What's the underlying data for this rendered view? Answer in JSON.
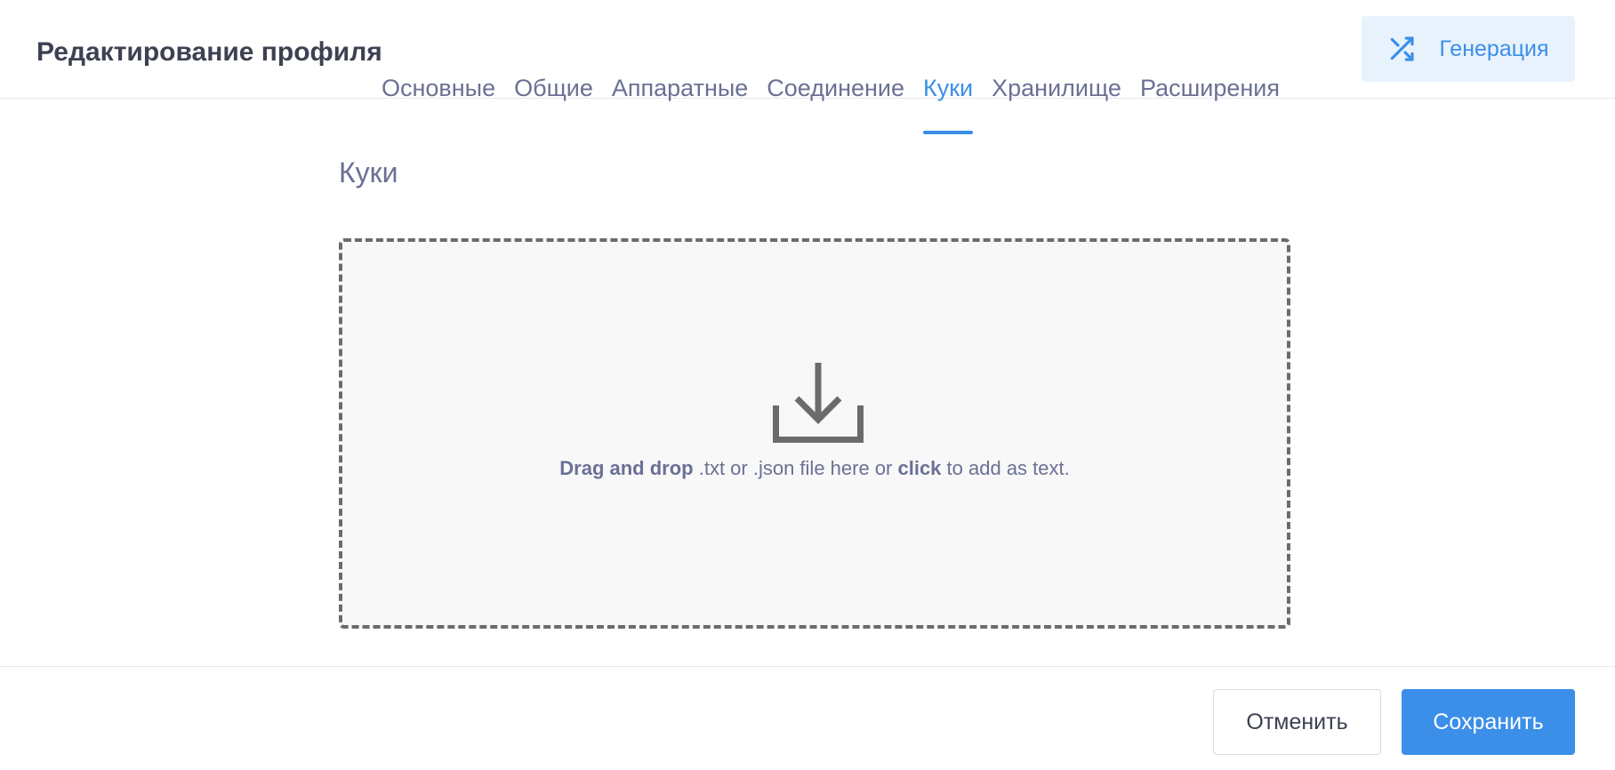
{
  "header": {
    "title": "Редактирование профиля",
    "generate_button": {
      "label": "Генерация",
      "icon": "shuffle-icon"
    }
  },
  "tabs": [
    {
      "label": "Основные",
      "active": false
    },
    {
      "label": "Общие",
      "active": false
    },
    {
      "label": "Аппаратные",
      "active": false
    },
    {
      "label": "Соединение",
      "active": false
    },
    {
      "label": "Куки",
      "active": true
    },
    {
      "label": "Хранилище",
      "active": false
    },
    {
      "label": "Расширения",
      "active": false
    }
  ],
  "cookies": {
    "section_title": "Куки",
    "dropzone": {
      "icon": "download-icon",
      "hint_bold_1": "Drag and drop",
      "hint_middle": " .txt or .json file here or ",
      "hint_bold_2": "click",
      "hint_end": " to add as text."
    }
  },
  "footer": {
    "cancel_label": "Отменить",
    "save_label": "Сохранить"
  },
  "colors": {
    "accent": "#3b8fe8",
    "accent_light": "#e8f2fd",
    "text_primary": "#3d4152",
    "text_secondary": "#6b7094",
    "dropzone_border": "#6b6b6b"
  }
}
